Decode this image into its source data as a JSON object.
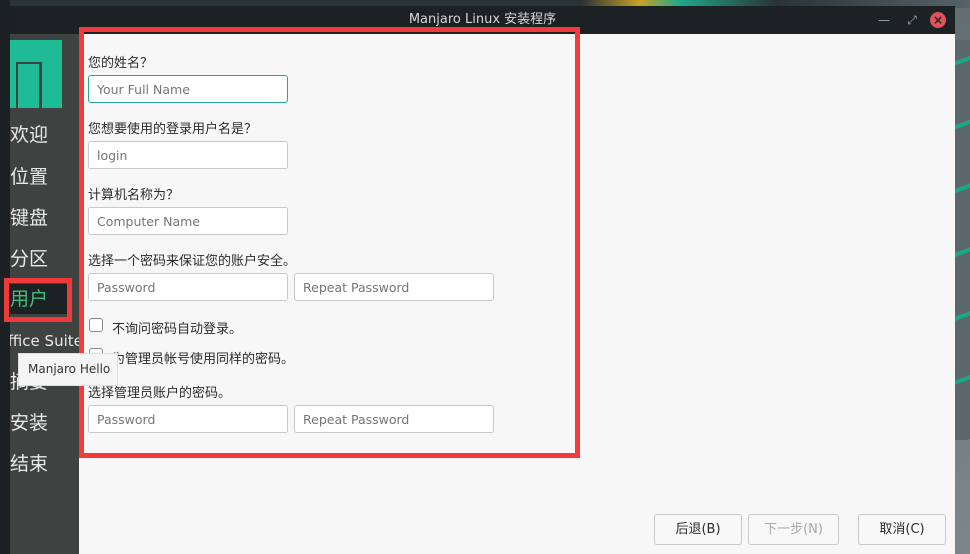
{
  "window": {
    "title": "Manjaro Linux 安装程序",
    "minimize_icon": "minimize-icon",
    "maximize_icon": "maximize-icon",
    "close_icon": "close-icon"
  },
  "sidebar": {
    "items": [
      {
        "label": "欢迎",
        "active": false
      },
      {
        "label": "位置",
        "active": false
      },
      {
        "label": "键盘",
        "active": false
      },
      {
        "label": "分区",
        "active": false
      },
      {
        "label": "用户",
        "active": true
      },
      {
        "label": "Office Suite",
        "active": false
      },
      {
        "label": "摘要",
        "active": false
      },
      {
        "label": "安装",
        "active": false
      },
      {
        "label": "结束",
        "active": false
      }
    ],
    "active_color": "#3fbf7f"
  },
  "tooltip": {
    "text": "Manjaro Hello"
  },
  "form": {
    "name_label": "您的姓名？",
    "name_placeholder": "Your Full Name",
    "login_label": "您想要使用的登录用户名是？",
    "login_placeholder": "login",
    "host_label": "计算机名称为？",
    "host_placeholder": "Computer Name",
    "password_label": "选择一个密码来保证您的账户安全。",
    "password_placeholder": "Password",
    "repeat_placeholder": "Repeat Password",
    "autologin_label": "不询问密码自动登录。",
    "autologin_checked": false,
    "same_password_label": "为管理员帐号使用同样的密码。",
    "same_password_checked": false,
    "root_label": "选择管理员账户的密码。",
    "root_password_placeholder": "Password",
    "root_repeat_placeholder": "Repeat Password"
  },
  "buttons": {
    "back": "后退(B)",
    "next": "下一步(N)",
    "cancel": "取消(C)"
  },
  "colors": {
    "accent": "#1dbb96",
    "annotation": "#f43a3a"
  }
}
